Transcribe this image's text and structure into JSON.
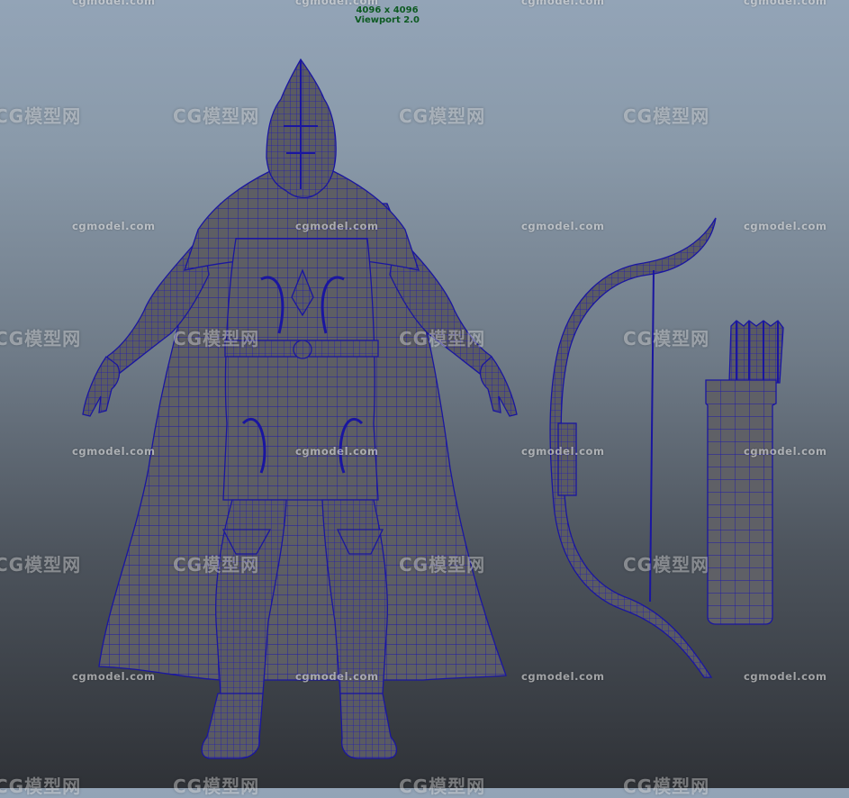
{
  "viewport": {
    "resolution_label": "4096 x 4096",
    "renderer_label": "Viewport 2.0"
  },
  "colors": {
    "background_top": "#93a4b7",
    "background_bottom": "#2f3237",
    "mesh_fill": "#5d5e64",
    "wireframe": "#1f1aa8",
    "hud_text": "#0d5a22"
  },
  "watermark": {
    "url": "cgmodel.com",
    "brand": "CG模型网"
  },
  "models": [
    {
      "name": "hooded-archer-character",
      "icon": "character-mesh"
    },
    {
      "name": "recurve-bow",
      "icon": "bow-mesh"
    },
    {
      "name": "arrow-quiver",
      "icon": "quiver-mesh"
    }
  ]
}
